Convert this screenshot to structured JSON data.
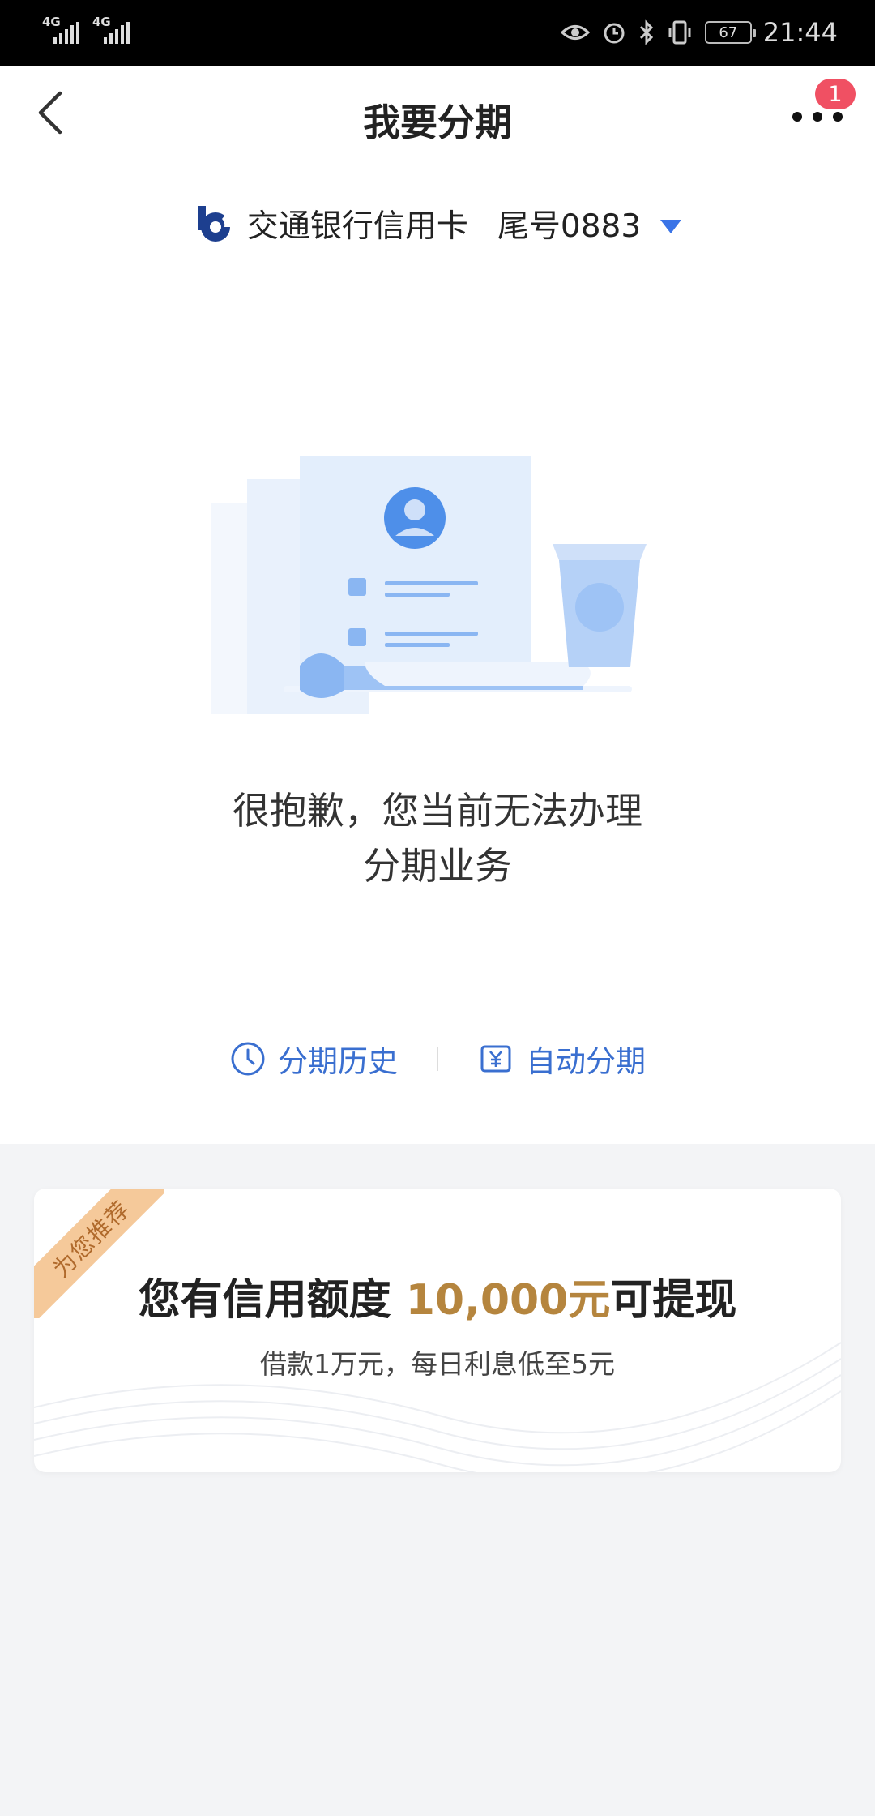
{
  "status_bar": {
    "network1": "4G",
    "network2": "4G",
    "battery": "67",
    "time": "21:44"
  },
  "header": {
    "title": "我要分期",
    "badge_count": "1"
  },
  "card": {
    "bank_name": "交通银行信用卡",
    "tail_number": "尾号0883"
  },
  "message": {
    "line1": "很抱歉，您当前无法办理",
    "line2": "分期业务"
  },
  "actions": {
    "history_label": "分期历史",
    "auto_label": "自动分期"
  },
  "promo": {
    "ribbon": "为您推荐",
    "title_prefix": "您有信用额度 ",
    "amount": "10,000元",
    "title_suffix": "可提现",
    "subtitle": "借款1万元，每日利息低至5元"
  },
  "colors": {
    "accent_blue": "#3a6fd0",
    "badge_red": "#f05063",
    "amount_gold": "#b5853e",
    "ribbon_bg": "#f5c99a"
  }
}
